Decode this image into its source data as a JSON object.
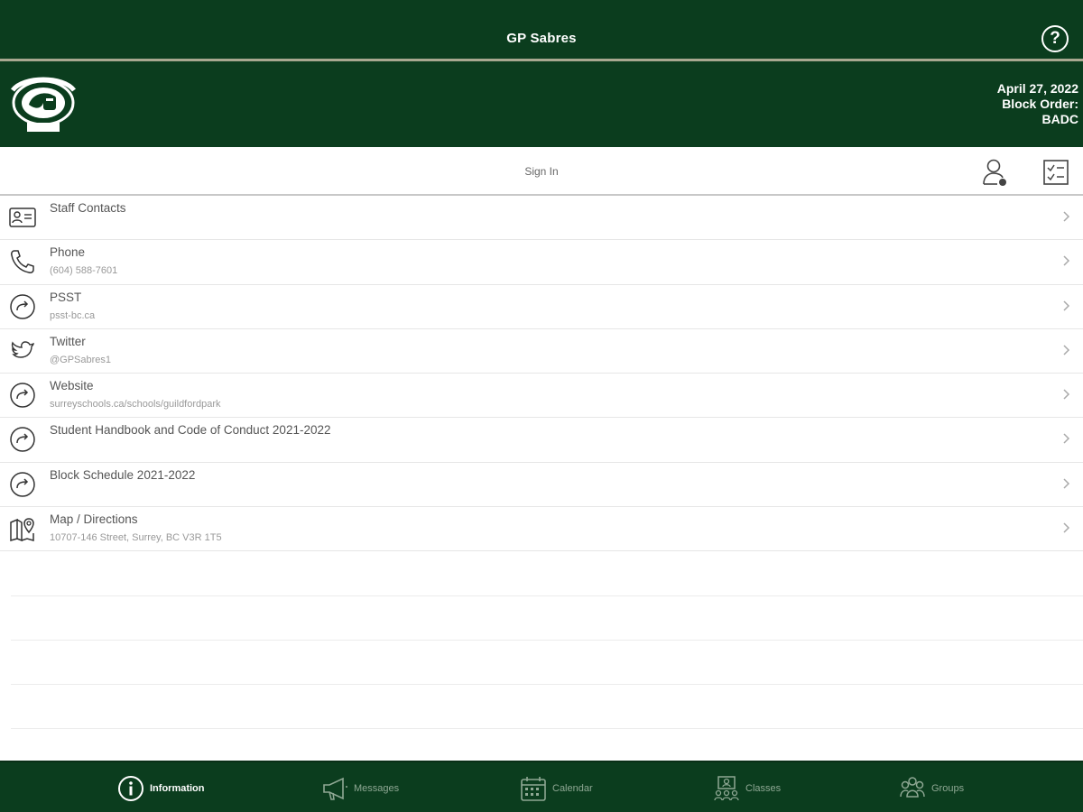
{
  "header": {
    "title": "GP Sabres",
    "help_label": "?"
  },
  "banner": {
    "logo_alt": "Guildford Park Sabres logo",
    "date": "April 27, 2022",
    "block_order_label": "Block Order:",
    "block_order_value": "BADC"
  },
  "signin": {
    "label": "Sign In"
  },
  "list": {
    "items": [
      {
        "title": "Staff Contacts",
        "subtitle": "",
        "icon": "contact-card-icon"
      },
      {
        "title": "Phone",
        "subtitle": "(604) 588-7601",
        "icon": "phone-icon"
      },
      {
        "title": "PSST",
        "subtitle": "psst-bc.ca",
        "icon": "share-arrow-icon"
      },
      {
        "title": "Twitter",
        "subtitle": "@GPSabres1",
        "icon": "twitter-icon"
      },
      {
        "title": "Website",
        "subtitle": "surreyschools.ca/schools/guildfordpark",
        "icon": "share-arrow-icon"
      },
      {
        "title": "Student Handbook and Code of Conduct 2021-2022",
        "subtitle": "",
        "icon": "share-arrow-icon"
      },
      {
        "title": "Block Schedule 2021-2022",
        "subtitle": "",
        "icon": "share-arrow-icon"
      },
      {
        "title": "Map / Directions",
        "subtitle": "10707-146 Street, Surrey, BC V3R 1T5",
        "icon": "map-pin-icon"
      }
    ]
  },
  "tabs": [
    {
      "label": "Information",
      "icon": "info-icon",
      "active": true
    },
    {
      "label": "Messages",
      "icon": "megaphone-icon",
      "active": false
    },
    {
      "label": "Calendar",
      "icon": "calendar-icon",
      "active": false
    },
    {
      "label": "Classes",
      "icon": "classes-icon",
      "active": false
    },
    {
      "label": "Groups",
      "icon": "groups-icon",
      "active": false
    }
  ],
  "colors": {
    "brand_green": "#0b3d1e",
    "rule_tan": "#a8a890",
    "inactive_tab": "#8fa894"
  }
}
